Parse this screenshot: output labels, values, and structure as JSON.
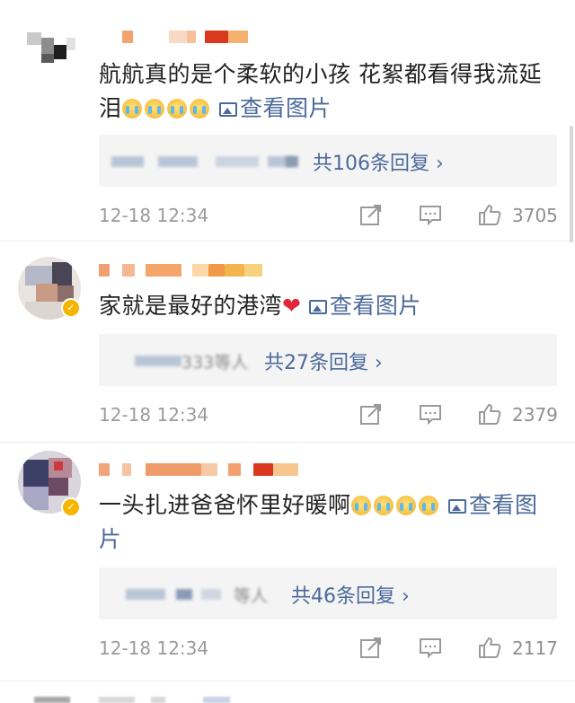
{
  "comments": [
    {
      "text": "航航真的是个柔软的小孩 花絮都看得我流延泪",
      "emoji": [
        "crying-emoji",
        "crying-emoji",
        "crying-emoji",
        "crying-emoji"
      ],
      "image_link": "查看图片",
      "replies": "共106条回复 ›",
      "time": "12-18 12:34",
      "likes": "3705"
    },
    {
      "text": "家就是最好的港湾",
      "heart": "❤",
      "image_link": "查看图片",
      "replies_prefix": "333等人",
      "replies": "共27条回复 ›",
      "time": "12-18 12:34",
      "likes": "2379"
    },
    {
      "text": "一头扎进爸爸怀里好暖啊",
      "emoji": [
        "crying-emoji",
        "crying-emoji",
        "crying-emoji",
        "crying-emoji"
      ],
      "image_link": "查看图片",
      "replies_prefix": "等人",
      "replies": "共46条回复 ›",
      "time": "12-18 12:34",
      "likes": "2117"
    }
  ],
  "colors": {
    "link": "#4b6a9b",
    "meta": "#9b9b9b",
    "reply_bg": "#f4f4f4",
    "verified": "#f7b500"
  }
}
